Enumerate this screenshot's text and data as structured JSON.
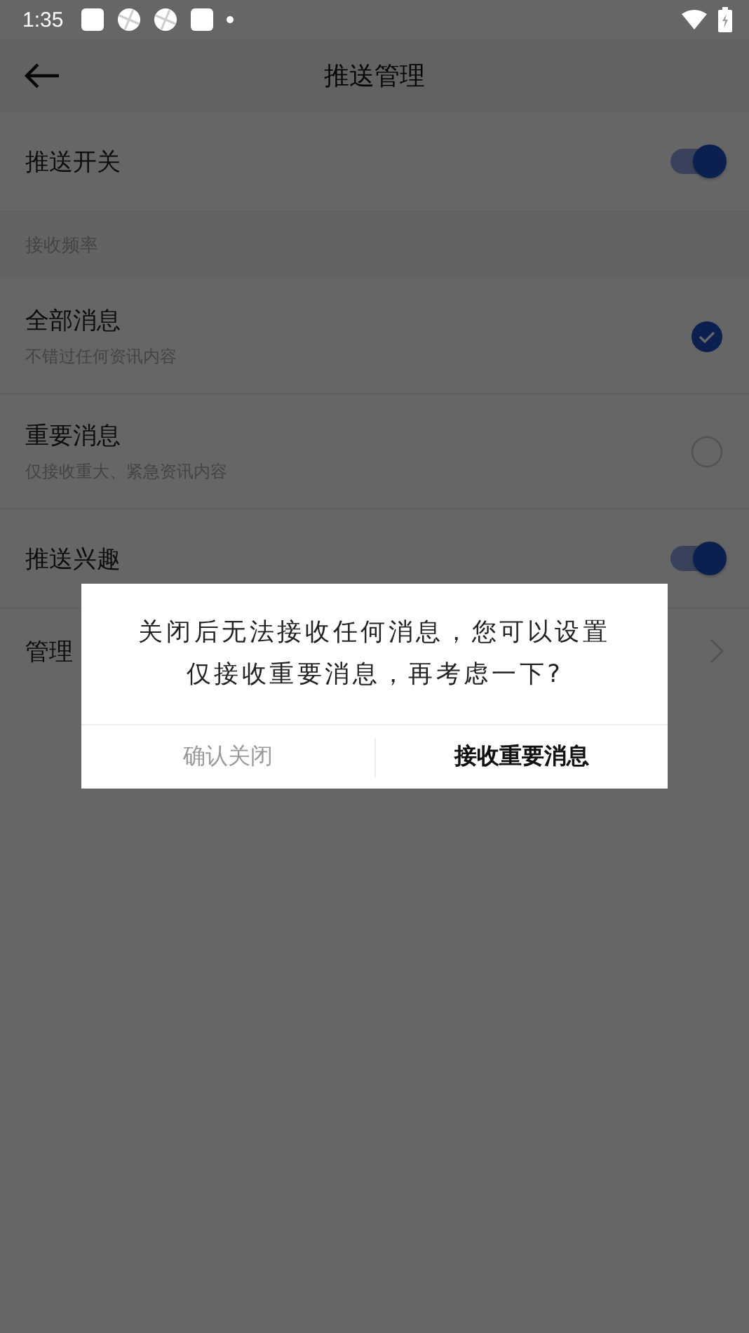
{
  "status_bar": {
    "time": "1:35"
  },
  "app_bar": {
    "title": "推送管理"
  },
  "settings": [
    {
      "kind": "toggle",
      "label": "推送开关",
      "on": true
    },
    {
      "kind": "section",
      "label": "接收频率"
    },
    {
      "kind": "radio",
      "label": "全部消息",
      "sublabel": "不错过任何资讯内容",
      "selected": true
    },
    {
      "kind": "radio",
      "label": "重要消息",
      "sublabel": "仅接收重大、紧急资讯内容",
      "selected": false
    },
    {
      "kind": "toggle",
      "label": "推送兴趣",
      "on": true
    },
    {
      "kind": "link",
      "label": "管理"
    }
  ],
  "dialog": {
    "message": "关闭后无法接收任何消息，您可以设置仅接收重要消息，再考虑一下?",
    "buttons": [
      {
        "label": "确认关闭",
        "primary": false
      },
      {
        "label": "接收重要消息",
        "primary": true
      }
    ]
  }
}
